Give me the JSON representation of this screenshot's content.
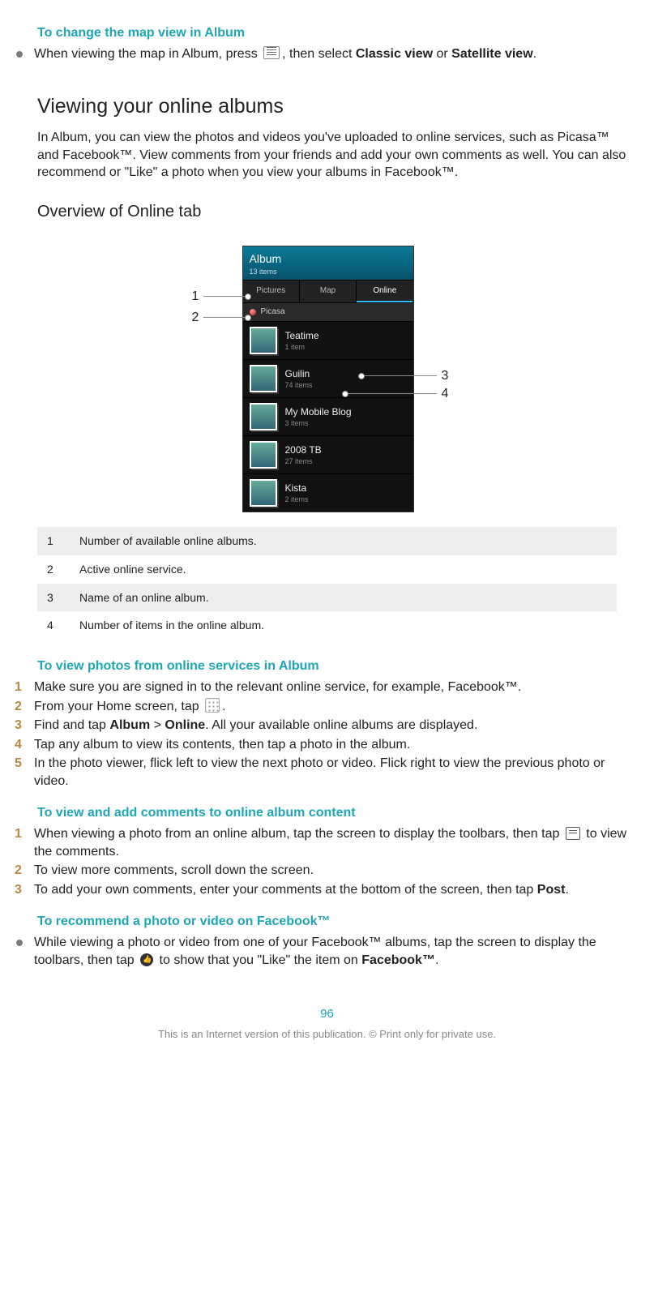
{
  "sec1": {
    "heading": "To change the map view in Album",
    "bullet_a": "When viewing the map in Album, press ",
    "bullet_b": ", then select ",
    "classic": "Classic view",
    "or": " or ",
    "sat": "Satellite view",
    "end": "."
  },
  "sec2": {
    "title": "Viewing your online albums",
    "para": "In Album, you can view the photos and videos you've uploaded to online services, such as Picasa™ and Facebook™. View comments from your friends and add your own comments as well. You can also recommend or \"Like\" a photo when you view your albums in Facebook™."
  },
  "sec3": {
    "title": "Overview of Online tab"
  },
  "phone": {
    "header_title": "Album",
    "header_sub": "13 items",
    "tabs": [
      "Pictures",
      "Map",
      "Online"
    ],
    "service": "Picasa",
    "albums": [
      {
        "name": "Teatime",
        "count": "1 item"
      },
      {
        "name": "Guilin",
        "count": "74 items"
      },
      {
        "name": "My Mobile Blog",
        "count": "3 items"
      },
      {
        "name": "2008 TB",
        "count": "27 items"
      },
      {
        "name": "Kista",
        "count": "2 items"
      }
    ]
  },
  "callouts": {
    "c1": "1",
    "c2": "2",
    "c3": "3",
    "c4": "4"
  },
  "legend": [
    {
      "n": "1",
      "t": "Number of available online albums."
    },
    {
      "n": "2",
      "t": "Active online service."
    },
    {
      "n": "3",
      "t": "Name of an online album."
    },
    {
      "n": "4",
      "t": "Number of items in the online album."
    }
  ],
  "sec4": {
    "heading": "To view photos from online services in Album",
    "steps": [
      "Make sure you are signed in to the relevant online service, for example, Facebook™.",
      {
        "a": "From your Home screen, tap ",
        "b": "."
      },
      {
        "a": "Find and tap ",
        "b1": "Album",
        "gt": " > ",
        "b2": "Online",
        "c": ". All your available online albums are displayed."
      },
      "Tap any album to view its contents, then tap a photo in the album.",
      "In the photo viewer, flick left to view the next photo or video. Flick right to view the previous photo or video."
    ]
  },
  "sec5": {
    "heading": "To view and add comments to online album content",
    "s1a": "When viewing a photo from an online album, tap the screen to display the toolbars, then tap ",
    "s1b": " to view the comments.",
    "s2": "To view more comments, scroll down the screen.",
    "s3a": "To add your own comments, enter your comments at the bottom of the screen, then tap ",
    "s3b": "Post",
    "s3c": "."
  },
  "sec6": {
    "heading": "To recommend a photo or video on Facebook™",
    "a": "While viewing a photo or video from one of your Facebook™ albums, tap the screen to display the toolbars, then tap ",
    "b": " to show that you \"Like\" the item on ",
    "fb": "Facebook™",
    "c": "."
  },
  "page": "96",
  "footer": "This is an Internet version of this publication. © Print only for private use."
}
